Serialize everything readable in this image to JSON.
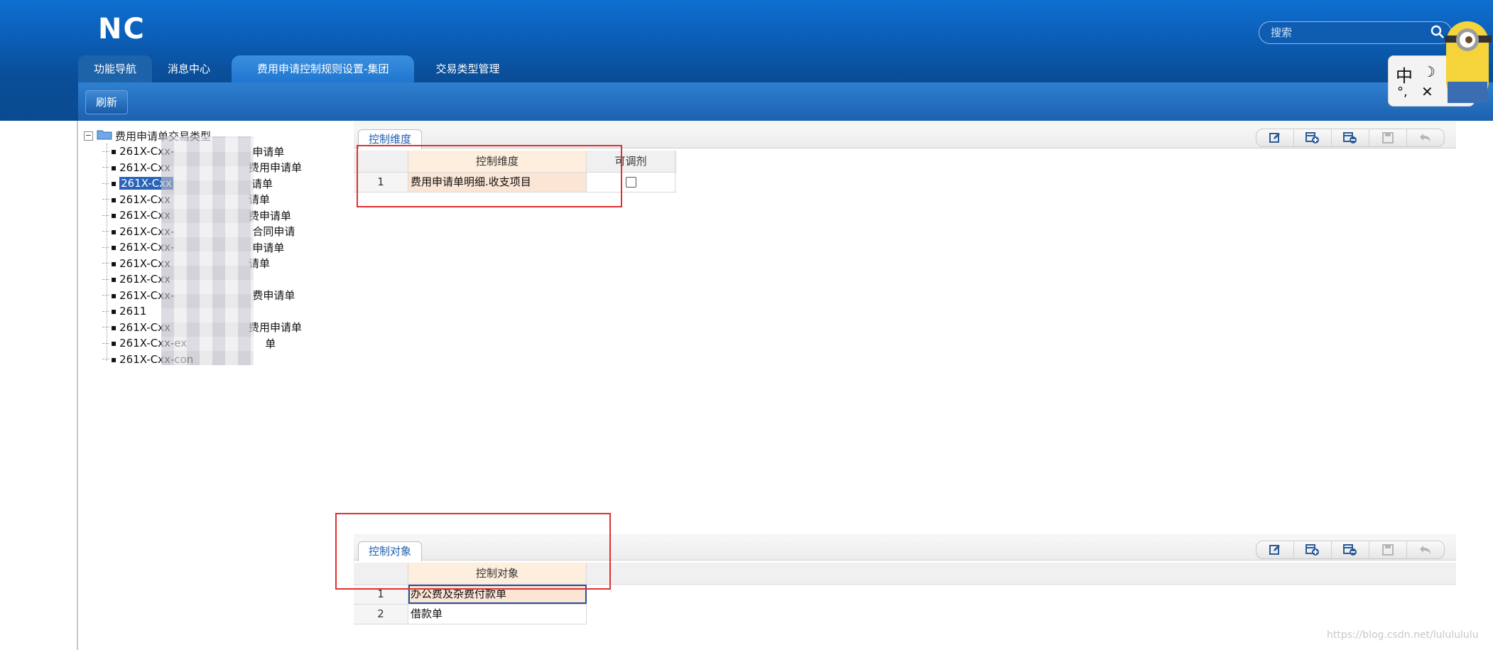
{
  "app": {
    "logo_text": "NC"
  },
  "search": {
    "placeholder": "搜索"
  },
  "tabs": [
    {
      "label": "功能导航"
    },
    {
      "label": "消息中心"
    },
    {
      "label": "费用申请控制规则设置-集团"
    },
    {
      "label": "交易类型管理"
    }
  ],
  "toolbar": {
    "refresh_label": "刷新"
  },
  "ime": {
    "mode": "中",
    "moon": "☽",
    "punct": "°,",
    "butterfly": "✕"
  },
  "tree": {
    "root_label": "费用申请单交易类型",
    "items": [
      {
        "label": "261X-Cxx-",
        "suffix": "申请单"
      },
      {
        "label": "261X-Cxx",
        "suffix": "费用申请单"
      },
      {
        "label": "261X-Cxx",
        "suffix": "请单",
        "selected": true
      },
      {
        "label": "261X-Cxx",
        "suffix": "请单"
      },
      {
        "label": "261X-Cxx",
        "suffix": "费申请单"
      },
      {
        "label": "261X-Cxx-",
        "suffix": "合同申请"
      },
      {
        "label": "261X-Cxx-",
        "suffix": "申请单"
      },
      {
        "label": "261X-Cxx",
        "suffix": "请单"
      },
      {
        "label": "261X-Cxx",
        "suffix": ""
      },
      {
        "label": "261X-Cxx-",
        "suffix": "费申请单"
      },
      {
        "label": "2611",
        "suffix": ""
      },
      {
        "label": "261X-Cxx",
        "suffix": "费用申请单"
      },
      {
        "label": "261X-Cxx-ex",
        "suffix": "单"
      },
      {
        "label": "261X-Cxx-con",
        "suffix": ""
      }
    ]
  },
  "control_dimension": {
    "tab_label": "控制维度",
    "columns": [
      "控制维度",
      "可调剂"
    ],
    "rows": [
      {
        "num": "1",
        "dimension": "费用申请单明细.收支项目",
        "adjustable": false
      }
    ]
  },
  "control_object": {
    "tab_label": "控制对象",
    "columns": [
      "控制对象"
    ],
    "rows": [
      {
        "num": "1",
        "object": "办公费及杂费付款单"
      },
      {
        "num": "2",
        "object": "借款单"
      }
    ]
  },
  "watermark": "https://blog.csdn.net/lululululu",
  "colors": {
    "header_blue": "#0b5fb9",
    "highlight": "#fbe5d4",
    "red_box": "#e03030",
    "link_blue": "#1f5fae"
  }
}
